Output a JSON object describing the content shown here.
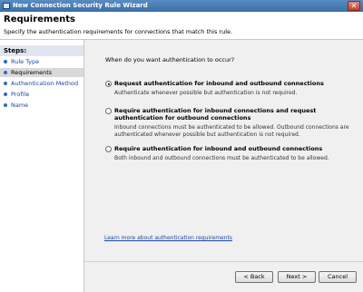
{
  "window": {
    "title": "New Connection Security Rule Wizard",
    "close_glyph": "✕"
  },
  "header": {
    "title": "Requirements",
    "subtitle": "Specify the authentication requirements for connections that match this rule."
  },
  "steps": {
    "heading": "Steps:",
    "items": [
      {
        "label": "Rule Type",
        "current": false
      },
      {
        "label": "Requirements",
        "current": true
      },
      {
        "label": "Authentication Method",
        "current": false
      },
      {
        "label": "Profile",
        "current": false
      },
      {
        "label": "Name",
        "current": false
      }
    ]
  },
  "main": {
    "question": "When do you want authentication to occur?",
    "options": [
      {
        "title": "Request authentication for inbound and outbound connections",
        "description": "Authenticate whenever possible but authentication is not required.",
        "selected": true
      },
      {
        "title": "Require authentication for inbound connections and request authentication for outbound connections",
        "description": "Inbound connections must be authenticated to be allowed. Outbound connections are authenticated whenever possible but authentication is not required.",
        "selected": false
      },
      {
        "title": "Require authentication for inbound and outbound connections",
        "description": "Both inbound and outbound connections must be authenticated to be allowed.",
        "selected": false
      }
    ],
    "learn_more": "Learn more about authentication requirements"
  },
  "buttons": {
    "back": "< Back",
    "next": "Next >",
    "cancel": "Cancel"
  }
}
